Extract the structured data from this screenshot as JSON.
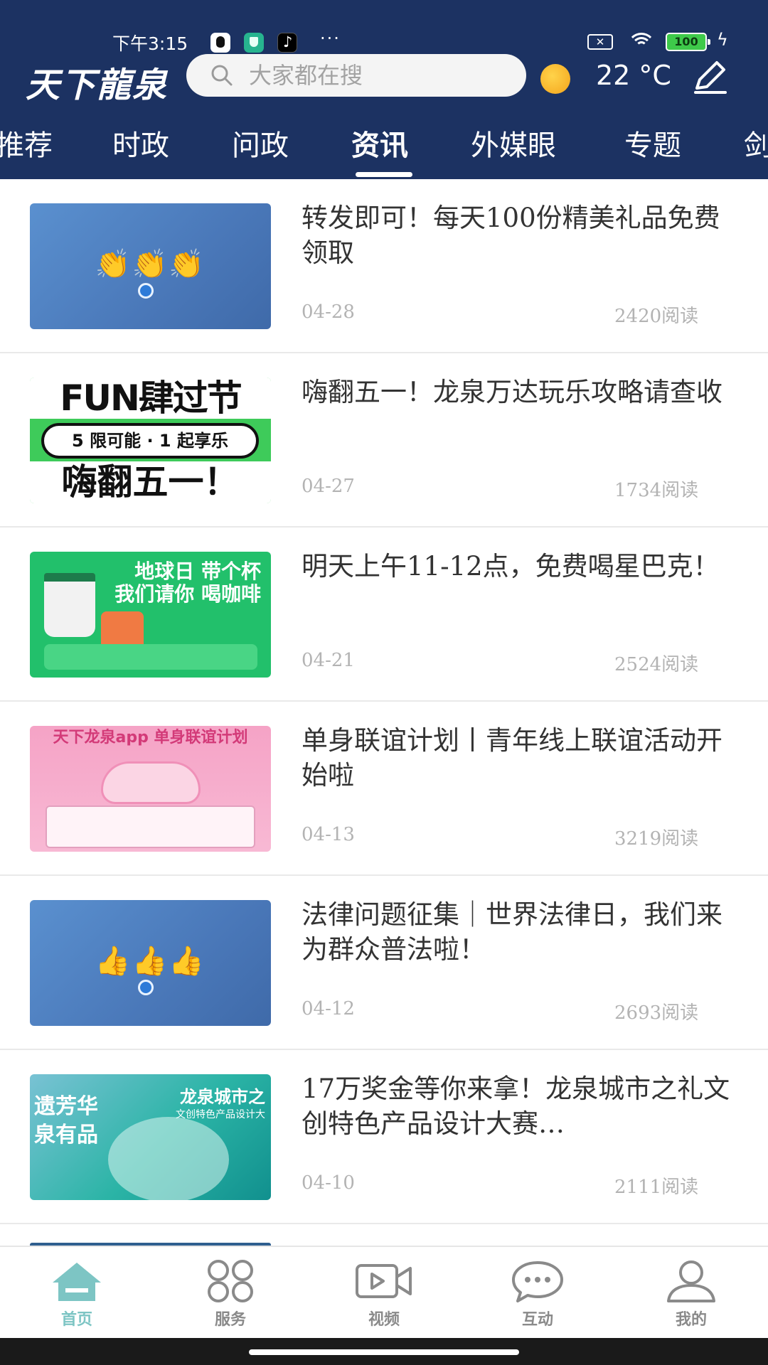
{
  "status_bar": {
    "time": "下午3:15",
    "more": "···",
    "battery": "100"
  },
  "header": {
    "logo": "天下龍泉",
    "search_placeholder": "大家都在搜",
    "weather_icon": "sun-icon",
    "temperature": "22 °C",
    "edit_icon": "pencil-icon"
  },
  "tabs": [
    {
      "label": "推荐",
      "active": false
    },
    {
      "label": "时政",
      "active": false
    },
    {
      "label": "问政",
      "active": false
    },
    {
      "label": "资讯",
      "active": true
    },
    {
      "label": "外媒眼",
      "active": false
    },
    {
      "label": "专题",
      "active": false
    },
    {
      "label": "剑",
      "active": false
    }
  ],
  "news": [
    {
      "title": "转发即可！每天100份精美礼品免费领取",
      "date": "04-28",
      "reads": "2420阅读"
    },
    {
      "title": "嗨翻五一！龙泉万达玩乐攻略请查收",
      "date": "04-27",
      "reads": "1734阅读",
      "thumb_text": {
        "top": "FUN肆过节",
        "middle": "5 限可能 · 1 起享乐",
        "bottom": "嗨翻五一！"
      }
    },
    {
      "title": "明天上午11-12点，免费喝星巴克！",
      "date": "04-21",
      "reads": "2524阅读",
      "thumb_text": {
        "top": "地球日 带个杯 我们请你 喝咖啡"
      }
    },
    {
      "title": "单身联谊计划丨青年线上联谊活动开始啦",
      "date": "04-13",
      "reads": "3219阅读",
      "thumb_text": {
        "top": "天下龙泉app 单身联谊计划"
      }
    },
    {
      "title": "法律问题征集｜世界法律日，我们来为群众普法啦！",
      "date": "04-12",
      "reads": "2693阅读"
    },
    {
      "title": "17万奖金等你来拿！龙泉城市之礼文创特色产品设计大赛…",
      "date": "04-10",
      "reads": "2111阅读",
      "thumb_text": {
        "left": "遗芳华 泉有品",
        "right": "龙泉城市之",
        "sub": "文创特色产品设计大"
      }
    }
  ],
  "bottom_nav": [
    {
      "label": "首页",
      "icon": "home-icon",
      "active": true
    },
    {
      "label": "服务",
      "icon": "grid-icon",
      "active": false
    },
    {
      "label": "视频",
      "icon": "video-icon",
      "active": false
    },
    {
      "label": "互动",
      "icon": "chat-icon",
      "active": false
    },
    {
      "label": "我的",
      "icon": "profile-icon",
      "active": false
    }
  ],
  "colors": {
    "header_bg": "#1c3262",
    "active_nav": "#7dc5c4",
    "text": "#333333",
    "meta": "#b3b3b3"
  }
}
